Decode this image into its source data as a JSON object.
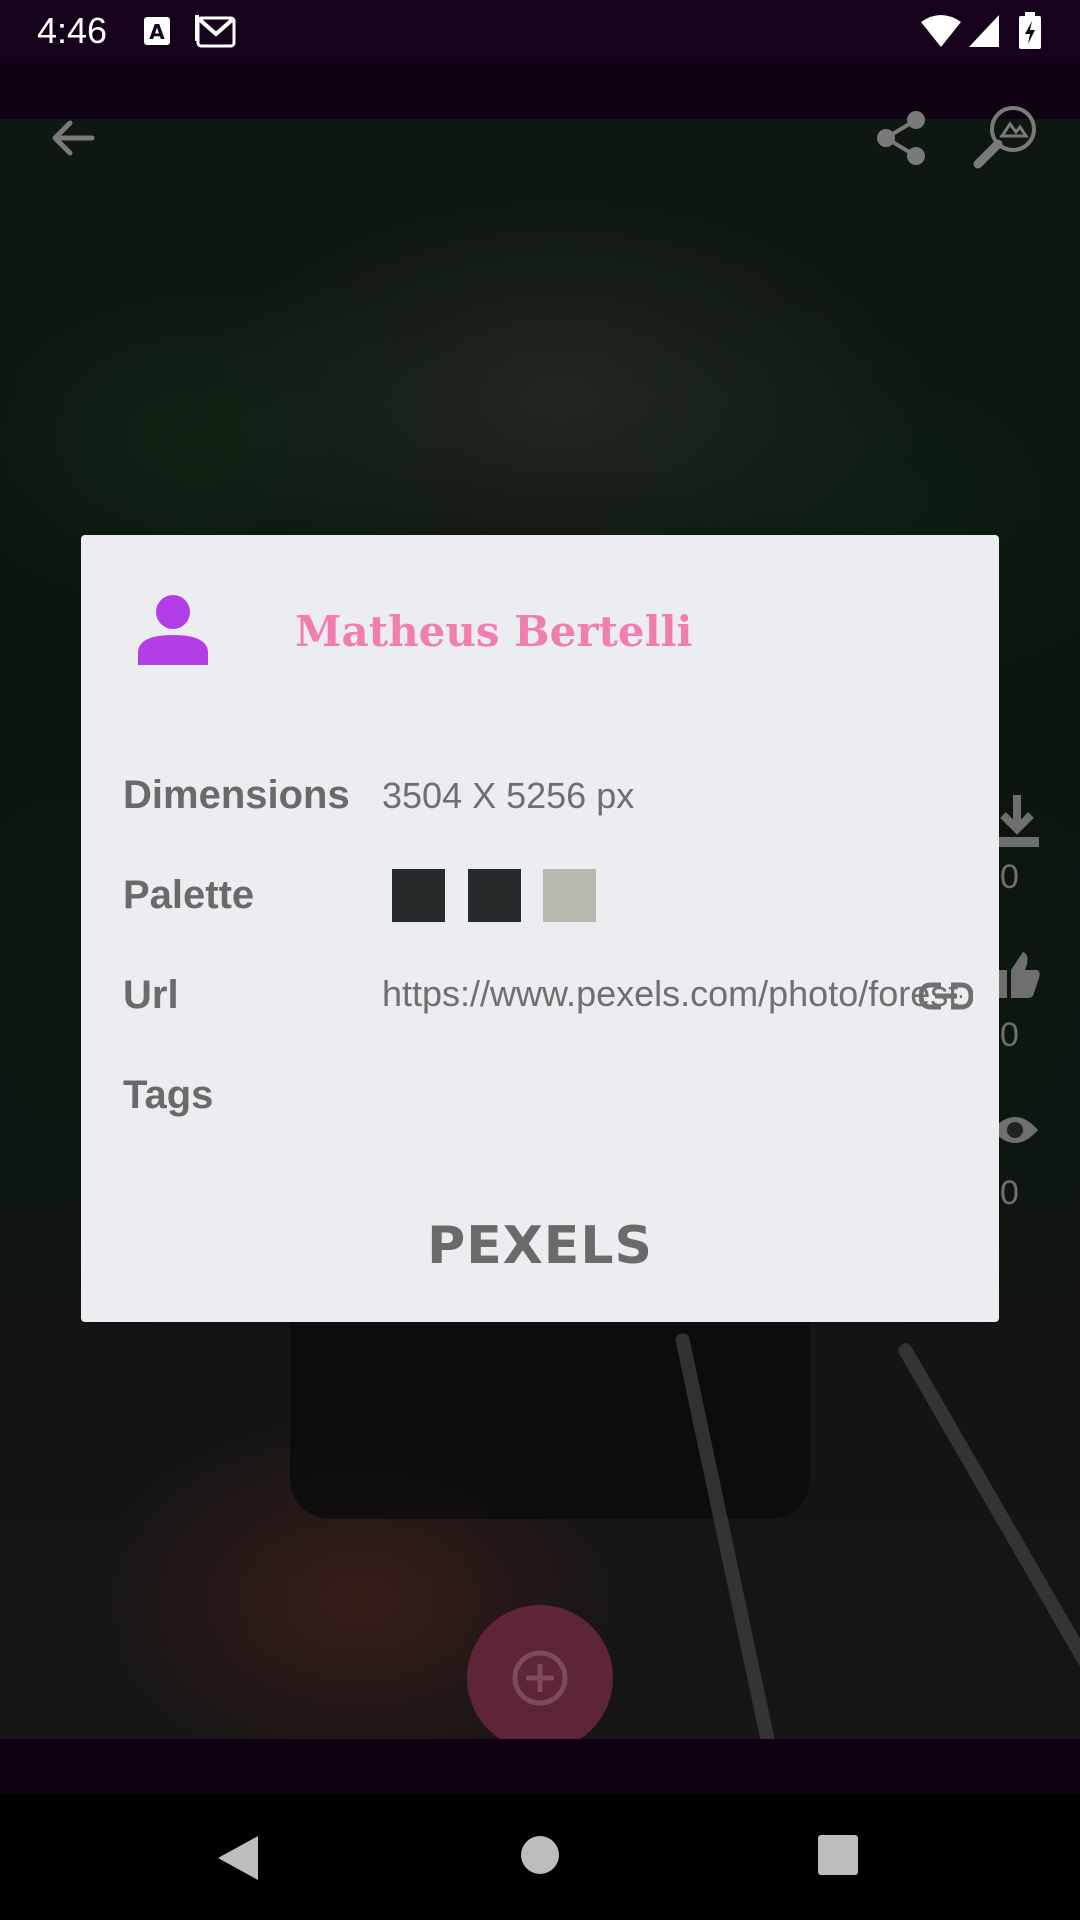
{
  "status_bar": {
    "time": "4:46",
    "icons": [
      "a-notification-icon",
      "gmail-icon",
      "wifi-icon",
      "signal-icon",
      "battery-icon"
    ]
  },
  "top_bar": {
    "icons": [
      "back-arrow-icon",
      "share-icon",
      "image-search-icon"
    ]
  },
  "side_stats": {
    "downloads": "0",
    "likes": "0",
    "views": "0"
  },
  "dialog": {
    "author_name": "Matheus Bertelli",
    "dimensions_label": "Dimensions",
    "dimensions_value": "3504 X 5256 px",
    "palette_label": "Palette",
    "palette": [
      "#242b2a",
      "#242b2a",
      "#b9b9b1"
    ],
    "url_label": "Url",
    "url_value": "https://www.pexels.com/photo/forest-road",
    "tags_label": "Tags",
    "source": "PEXELS",
    "author_icon_color": "#b43ee6",
    "author_name_color": "#f07fb0"
  },
  "fab": {
    "icon": "add-circle-icon",
    "color": "#5e2437"
  },
  "nav_bar": {
    "buttons": [
      "back",
      "home",
      "recents"
    ]
  }
}
